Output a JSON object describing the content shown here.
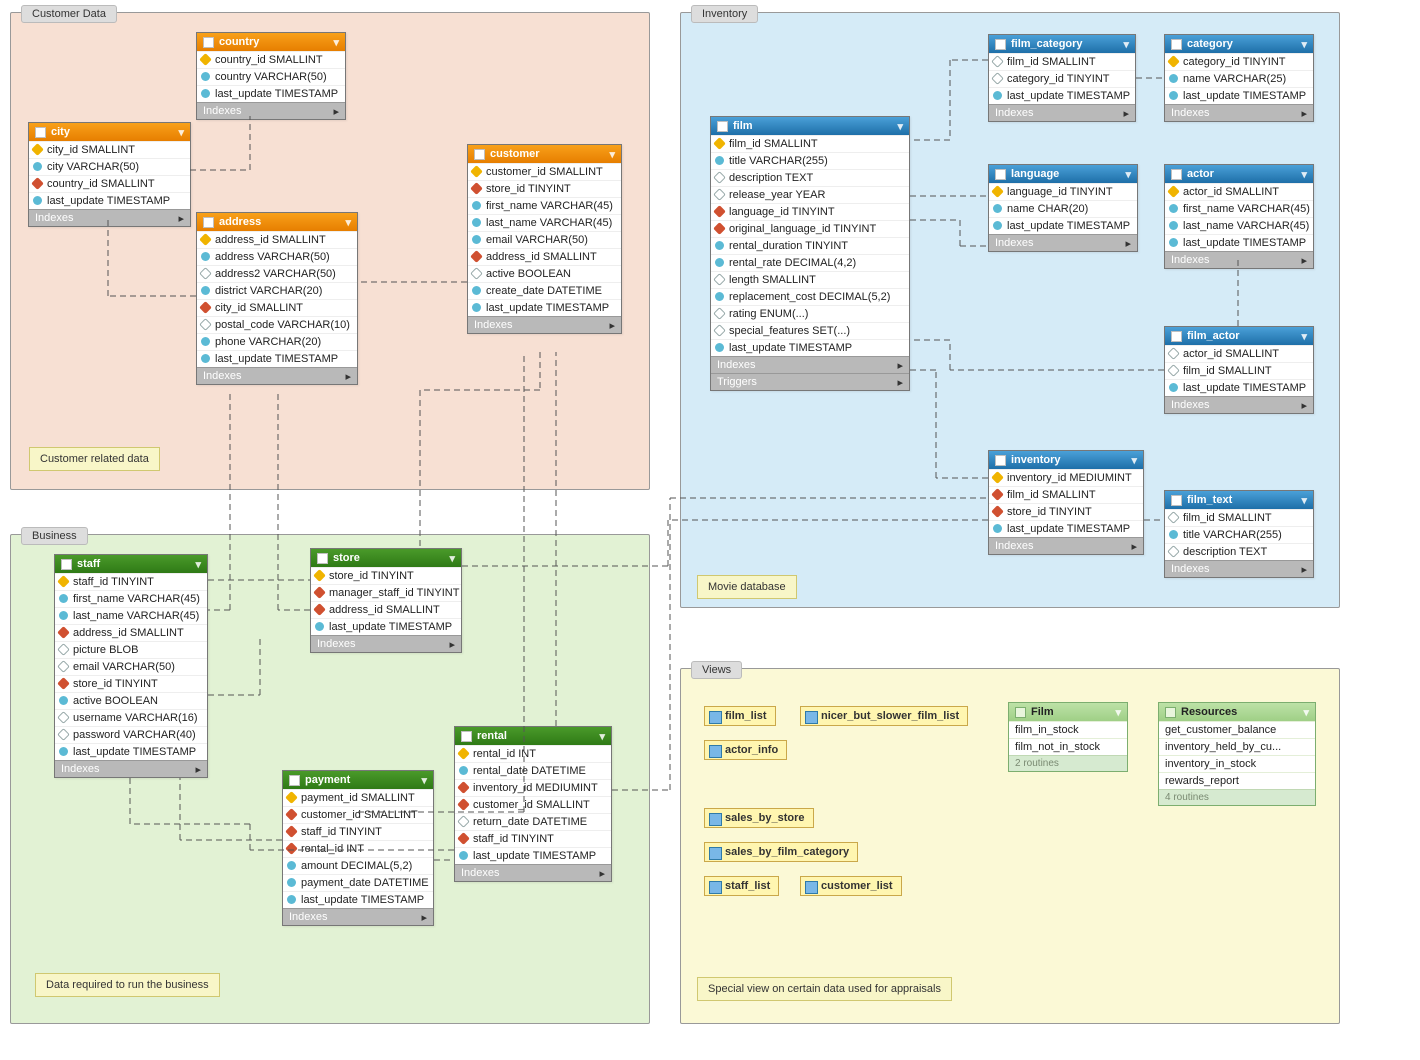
{
  "regions": {
    "customer": {
      "label": "Customer Data",
      "note": "Customer related data"
    },
    "business": {
      "label": "Business",
      "note": "Data required to run the business"
    },
    "inventory": {
      "label": "Inventory",
      "note": "Movie database"
    },
    "views": {
      "label": "Views",
      "note": "Special view on certain data used for appraisals"
    }
  },
  "sections": {
    "indexes": "Indexes",
    "triggers": "Triggers"
  },
  "tables": {
    "country": {
      "name": "country",
      "columns": [
        {
          "t": "country_id SMALLINT",
          "k": "pk"
        },
        {
          "t": "country VARCHAR(50)",
          "k": "idx"
        },
        {
          "t": "last_update TIMESTAMP",
          "k": "idx"
        }
      ]
    },
    "city": {
      "name": "city",
      "columns": [
        {
          "t": "city_id SMALLINT",
          "k": "pk"
        },
        {
          "t": "city VARCHAR(50)",
          "k": "idx"
        },
        {
          "t": "country_id SMALLINT",
          "k": "fk"
        },
        {
          "t": "last_update TIMESTAMP",
          "k": "idx"
        }
      ]
    },
    "address": {
      "name": "address",
      "columns": [
        {
          "t": "address_id SMALLINT",
          "k": "pk"
        },
        {
          "t": "address VARCHAR(50)",
          "k": "idx"
        },
        {
          "t": "address2 VARCHAR(50)",
          "k": "col"
        },
        {
          "t": "district VARCHAR(20)",
          "k": "idx"
        },
        {
          "t": "city_id SMALLINT",
          "k": "fk"
        },
        {
          "t": "postal_code VARCHAR(10)",
          "k": "col"
        },
        {
          "t": "phone VARCHAR(20)",
          "k": "idx"
        },
        {
          "t": "last_update TIMESTAMP",
          "k": "idx"
        }
      ]
    },
    "customer": {
      "name": "customer",
      "columns": [
        {
          "t": "customer_id SMALLINT",
          "k": "pk"
        },
        {
          "t": "store_id TINYINT",
          "k": "fk"
        },
        {
          "t": "first_name VARCHAR(45)",
          "k": "idx"
        },
        {
          "t": "last_name VARCHAR(45)",
          "k": "idx"
        },
        {
          "t": "email VARCHAR(50)",
          "k": "idx"
        },
        {
          "t": "address_id SMALLINT",
          "k": "fk"
        },
        {
          "t": "active BOOLEAN",
          "k": "col"
        },
        {
          "t": "create_date DATETIME",
          "k": "idx"
        },
        {
          "t": "last_update TIMESTAMP",
          "k": "idx"
        }
      ]
    },
    "staff": {
      "name": "staff",
      "columns": [
        {
          "t": "staff_id TINYINT",
          "k": "pk"
        },
        {
          "t": "first_name VARCHAR(45)",
          "k": "idx"
        },
        {
          "t": "last_name VARCHAR(45)",
          "k": "idx"
        },
        {
          "t": "address_id SMALLINT",
          "k": "fk"
        },
        {
          "t": "picture BLOB",
          "k": "col"
        },
        {
          "t": "email VARCHAR(50)",
          "k": "col"
        },
        {
          "t": "store_id TINYINT",
          "k": "fk"
        },
        {
          "t": "active BOOLEAN",
          "k": "idx"
        },
        {
          "t": "username VARCHAR(16)",
          "k": "col"
        },
        {
          "t": "password VARCHAR(40)",
          "k": "col"
        },
        {
          "t": "last_update TIMESTAMP",
          "k": "idx"
        }
      ]
    },
    "store": {
      "name": "store",
      "columns": [
        {
          "t": "store_id TINYINT",
          "k": "pk"
        },
        {
          "t": "manager_staff_id TINYINT",
          "k": "fk"
        },
        {
          "t": "address_id SMALLINT",
          "k": "fk"
        },
        {
          "t": "last_update TIMESTAMP",
          "k": "idx"
        }
      ]
    },
    "payment": {
      "name": "payment",
      "columns": [
        {
          "t": "payment_id SMALLINT",
          "k": "pk"
        },
        {
          "t": "customer_id SMALLINT",
          "k": "fk"
        },
        {
          "t": "staff_id TINYINT",
          "k": "fk"
        },
        {
          "t": "rental_id INT",
          "k": "fk"
        },
        {
          "t": "amount DECIMAL(5,2)",
          "k": "idx"
        },
        {
          "t": "payment_date DATETIME",
          "k": "idx"
        },
        {
          "t": "last_update TIMESTAMP",
          "k": "idx"
        }
      ]
    },
    "rental": {
      "name": "rental",
      "columns": [
        {
          "t": "rental_id INT",
          "k": "pk"
        },
        {
          "t": "rental_date DATETIME",
          "k": "idx"
        },
        {
          "t": "inventory_id MEDIUMINT",
          "k": "fk"
        },
        {
          "t": "customer_id SMALLINT",
          "k": "fk"
        },
        {
          "t": "return_date DATETIME",
          "k": "col"
        },
        {
          "t": "staff_id TINYINT",
          "k": "fk"
        },
        {
          "t": "last_update TIMESTAMP",
          "k": "idx"
        }
      ]
    },
    "film": {
      "name": "film",
      "columns": [
        {
          "t": "film_id SMALLINT",
          "k": "pk"
        },
        {
          "t": "title VARCHAR(255)",
          "k": "idx"
        },
        {
          "t": "description TEXT",
          "k": "col"
        },
        {
          "t": "release_year YEAR",
          "k": "col"
        },
        {
          "t": "language_id TINYINT",
          "k": "fk"
        },
        {
          "t": "original_language_id TINYINT",
          "k": "fk"
        },
        {
          "t": "rental_duration TINYINT",
          "k": "idx"
        },
        {
          "t": "rental_rate DECIMAL(4,2)",
          "k": "idx"
        },
        {
          "t": "length SMALLINT",
          "k": "col"
        },
        {
          "t": "replacement_cost DECIMAL(5,2)",
          "k": "idx"
        },
        {
          "t": "rating ENUM(...)",
          "k": "col"
        },
        {
          "t": "special_features SET(...)",
          "k": "col"
        },
        {
          "t": "last_update TIMESTAMP",
          "k": "idx"
        }
      ]
    },
    "film_category": {
      "name": "film_category",
      "columns": [
        {
          "t": "film_id SMALLINT",
          "k": "col"
        },
        {
          "t": "category_id TINYINT",
          "k": "col"
        },
        {
          "t": "last_update TIMESTAMP",
          "k": "idx"
        }
      ]
    },
    "category": {
      "name": "category",
      "columns": [
        {
          "t": "category_id TINYINT",
          "k": "pk"
        },
        {
          "t": "name VARCHAR(25)",
          "k": "idx"
        },
        {
          "t": "last_update TIMESTAMP",
          "k": "idx"
        }
      ]
    },
    "language": {
      "name": "language",
      "columns": [
        {
          "t": "language_id TINYINT",
          "k": "pk"
        },
        {
          "t": "name CHAR(20)",
          "k": "idx"
        },
        {
          "t": "last_update TIMESTAMP",
          "k": "idx"
        }
      ]
    },
    "actor": {
      "name": "actor",
      "columns": [
        {
          "t": "actor_id SMALLINT",
          "k": "pk"
        },
        {
          "t": "first_name VARCHAR(45)",
          "k": "idx"
        },
        {
          "t": "last_name VARCHAR(45)",
          "k": "idx"
        },
        {
          "t": "last_update TIMESTAMP",
          "k": "idx"
        }
      ]
    },
    "film_actor": {
      "name": "film_actor",
      "columns": [
        {
          "t": "actor_id SMALLINT",
          "k": "col"
        },
        {
          "t": "film_id SMALLINT",
          "k": "col"
        },
        {
          "t": "last_update TIMESTAMP",
          "k": "idx"
        }
      ]
    },
    "inventory": {
      "name": "inventory",
      "columns": [
        {
          "t": "inventory_id MEDIUMINT",
          "k": "pk"
        },
        {
          "t": "film_id SMALLINT",
          "k": "fk"
        },
        {
          "t": "store_id TINYINT",
          "k": "fk"
        },
        {
          "t": "last_update TIMESTAMP",
          "k": "idx"
        }
      ]
    },
    "film_text": {
      "name": "film_text",
      "columns": [
        {
          "t": "film_id SMALLINT",
          "k": "col"
        },
        {
          "t": "title VARCHAR(255)",
          "k": "idx"
        },
        {
          "t": "description TEXT",
          "k": "col"
        }
      ]
    }
  },
  "views": {
    "film_list": "film_list",
    "nicer_but_slower_film_list": "nicer_but_slower_film_list",
    "actor_info": "actor_info",
    "sales_by_store": "sales_by_store",
    "sales_by_film_category": "sales_by_film_category",
    "staff_list": "staff_list",
    "customer_list": "customer_list"
  },
  "routines": {
    "film": {
      "title": "Film",
      "footer": "2 routines",
      "rows": [
        "film_in_stock",
        "film_not_in_stock"
      ]
    },
    "resources": {
      "title": "Resources",
      "footer": "4 routines",
      "rows": [
        "get_customer_balance",
        "inventory_held_by_cu...",
        "inventory_in_stock",
        "rewards_report"
      ]
    }
  }
}
